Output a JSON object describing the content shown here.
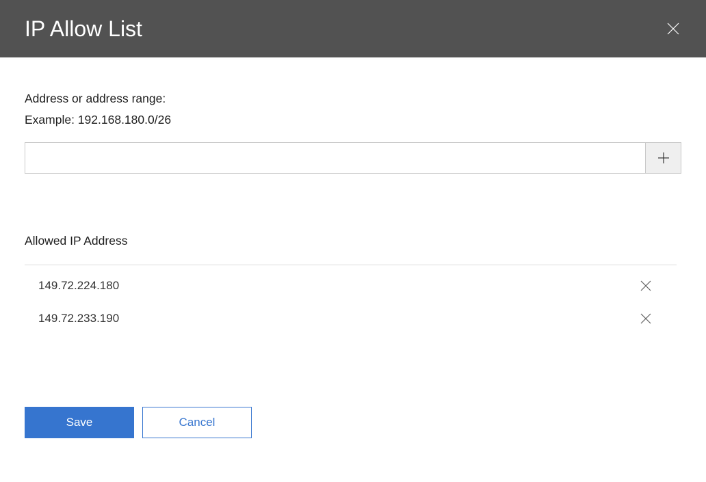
{
  "header": {
    "title": "IP Allow List"
  },
  "form": {
    "label": "Address or address range:",
    "example": "Example: 192.168.180.0/26",
    "input_value": ""
  },
  "list": {
    "title": "Allowed IP Address",
    "items": [
      {
        "ip": "149.72.224.180"
      },
      {
        "ip": "149.72.233.190"
      }
    ]
  },
  "footer": {
    "save_label": "Save",
    "cancel_label": "Cancel"
  }
}
